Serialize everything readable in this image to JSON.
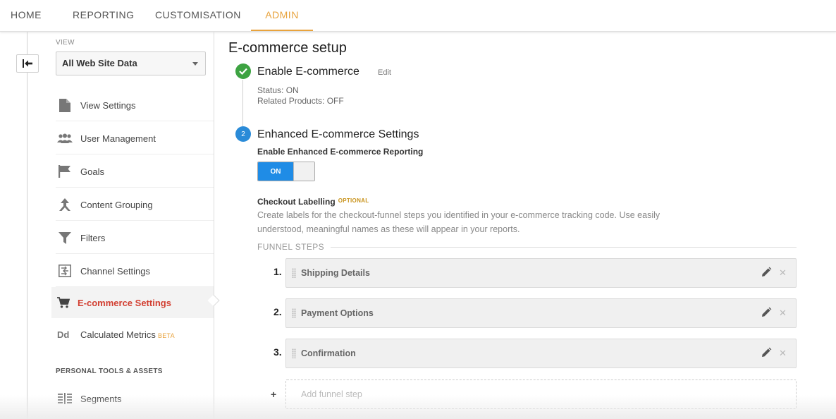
{
  "topnav": {
    "items": [
      {
        "label": "HOME",
        "active": false
      },
      {
        "label": "REPORTING",
        "active": false
      },
      {
        "label": "CUSTOMISATION",
        "active": false
      },
      {
        "label": "ADMIN",
        "active": true
      }
    ],
    "accent_color": "#e8a33d"
  },
  "sidebar": {
    "view_label": "VIEW",
    "view_selected": "All Web Site Data",
    "items": [
      {
        "label": "View Settings",
        "icon": "document-icon"
      },
      {
        "label": "User Management",
        "icon": "users-icon"
      },
      {
        "label": "Goals",
        "icon": "flag-icon"
      },
      {
        "label": "Content Grouping",
        "icon": "content-grouping-icon"
      },
      {
        "label": "Filters",
        "icon": "filter-icon"
      },
      {
        "label": "Channel Settings",
        "icon": "channel-settings-icon"
      },
      {
        "label": "E-commerce Settings",
        "icon": "cart-icon",
        "active": true
      },
      {
        "label": "Calculated Metrics",
        "icon": "calculated-metrics-icon",
        "badge": "BETA"
      }
    ],
    "section_label": "PERSONAL TOOLS & ASSETS",
    "section_items": [
      {
        "label": "Segments",
        "icon": "segments-icon"
      }
    ],
    "active_color": "#d23f31"
  },
  "main": {
    "title": "E-commerce setup",
    "step1": {
      "title": "Enable E-commerce",
      "edit_label": "Edit",
      "status": "Status: ON",
      "related": "Related Products: OFF",
      "check_color": "#3da342"
    },
    "step2": {
      "number": "2",
      "title": "Enhanced E-commerce Settings",
      "reporting_label": "Enable Enhanced E-commerce Reporting",
      "toggle_label": "ON",
      "toggle_color": "#1f8ce6"
    },
    "checkout": {
      "title": "Checkout Labelling",
      "optional": "OPTIONAL",
      "description": "Create labels for the checkout-funnel steps you identified in your e-commerce tracking code. Use easily understood, meaningful names as these will appear in your reports."
    },
    "funnel": {
      "label": "FUNNEL STEPS",
      "steps": [
        {
          "number": "1.",
          "name": "Shipping Details"
        },
        {
          "number": "2.",
          "name": "Payment Options"
        },
        {
          "number": "3.",
          "name": "Confirmation"
        }
      ],
      "add_symbol": "+",
      "add_placeholder": "Add funnel step"
    }
  }
}
